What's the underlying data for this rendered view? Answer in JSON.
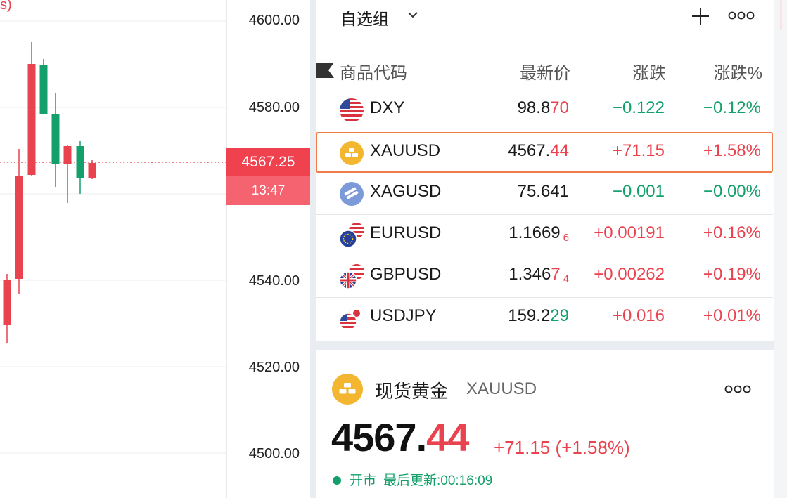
{
  "chart": {
    "corner_label": "s)",
    "axis_ticks": [
      "4600.00",
      "4580.00",
      "4540.00",
      "4520.00",
      "4500.00"
    ],
    "current_price": "4567.25",
    "countdown": "13:47"
  },
  "watchlist": {
    "title": "自选组",
    "columns": [
      "商品代码",
      "最新价",
      "涨跌",
      "涨跌%"
    ],
    "rows": [
      {
        "symbol": "DXY",
        "last_main": "98.8",
        "last_tail": "70",
        "last_sub": "",
        "main_color": "dark",
        "tail_color": "red",
        "change": "−0.122",
        "change_color": "green",
        "pct": "−0.12%",
        "pct_color": "green",
        "icon": "us-flag-icon"
      },
      {
        "symbol": "XAUUSD",
        "last_main": "4567.",
        "last_tail": "44",
        "last_sub": "",
        "main_color": "dark",
        "tail_color": "red",
        "change": "+71.15",
        "change_color": "red",
        "pct": "+1.58%",
        "pct_color": "red",
        "icon": "gold-icon"
      },
      {
        "symbol": "XAGUSD",
        "last_main": "75.641",
        "last_tail": "",
        "last_sub": "",
        "main_color": "red",
        "tail_color": "red",
        "change": "−0.001",
        "change_color": "green",
        "pct": "−0.00%",
        "pct_color": "green",
        "icon": "silver-icon"
      },
      {
        "symbol": "EURUSD",
        "last_main": "1.1669",
        "last_tail": "",
        "last_sub": "6",
        "main_color": "dark",
        "tail_color": "red",
        "change": "+0.00191",
        "change_color": "red",
        "pct": "+0.16%",
        "pct_color": "red",
        "icon": "eur-usd-flag-icon"
      },
      {
        "symbol": "GBPUSD",
        "last_main": "1.346",
        "last_tail": "7",
        "last_sub": "4",
        "main_color": "dark",
        "tail_color": "red",
        "change": "+0.00262",
        "change_color": "red",
        "pct": "+0.19%",
        "pct_color": "red",
        "icon": "gbp-usd-flag-icon"
      },
      {
        "symbol": "USDJPY",
        "last_main": "159.2",
        "last_tail": "29",
        "last_sub": "",
        "main_color": "dark",
        "tail_color": "green",
        "change": "+0.016",
        "change_color": "red",
        "pct": "+0.01%",
        "pct_color": "red",
        "icon": "usd-jpy-flag-icon"
      }
    ]
  },
  "quote": {
    "name": "现货黄金",
    "code": "XAUUSD",
    "price_int": "4567.",
    "price_dec": "44",
    "change": "+71.15 (+1.58%)",
    "status": "开市",
    "updated": "最后更新:00:16:09"
  },
  "colors": {
    "up": "#e8434f",
    "down": "#14a06a",
    "highlight": "#ef7d45"
  }
}
